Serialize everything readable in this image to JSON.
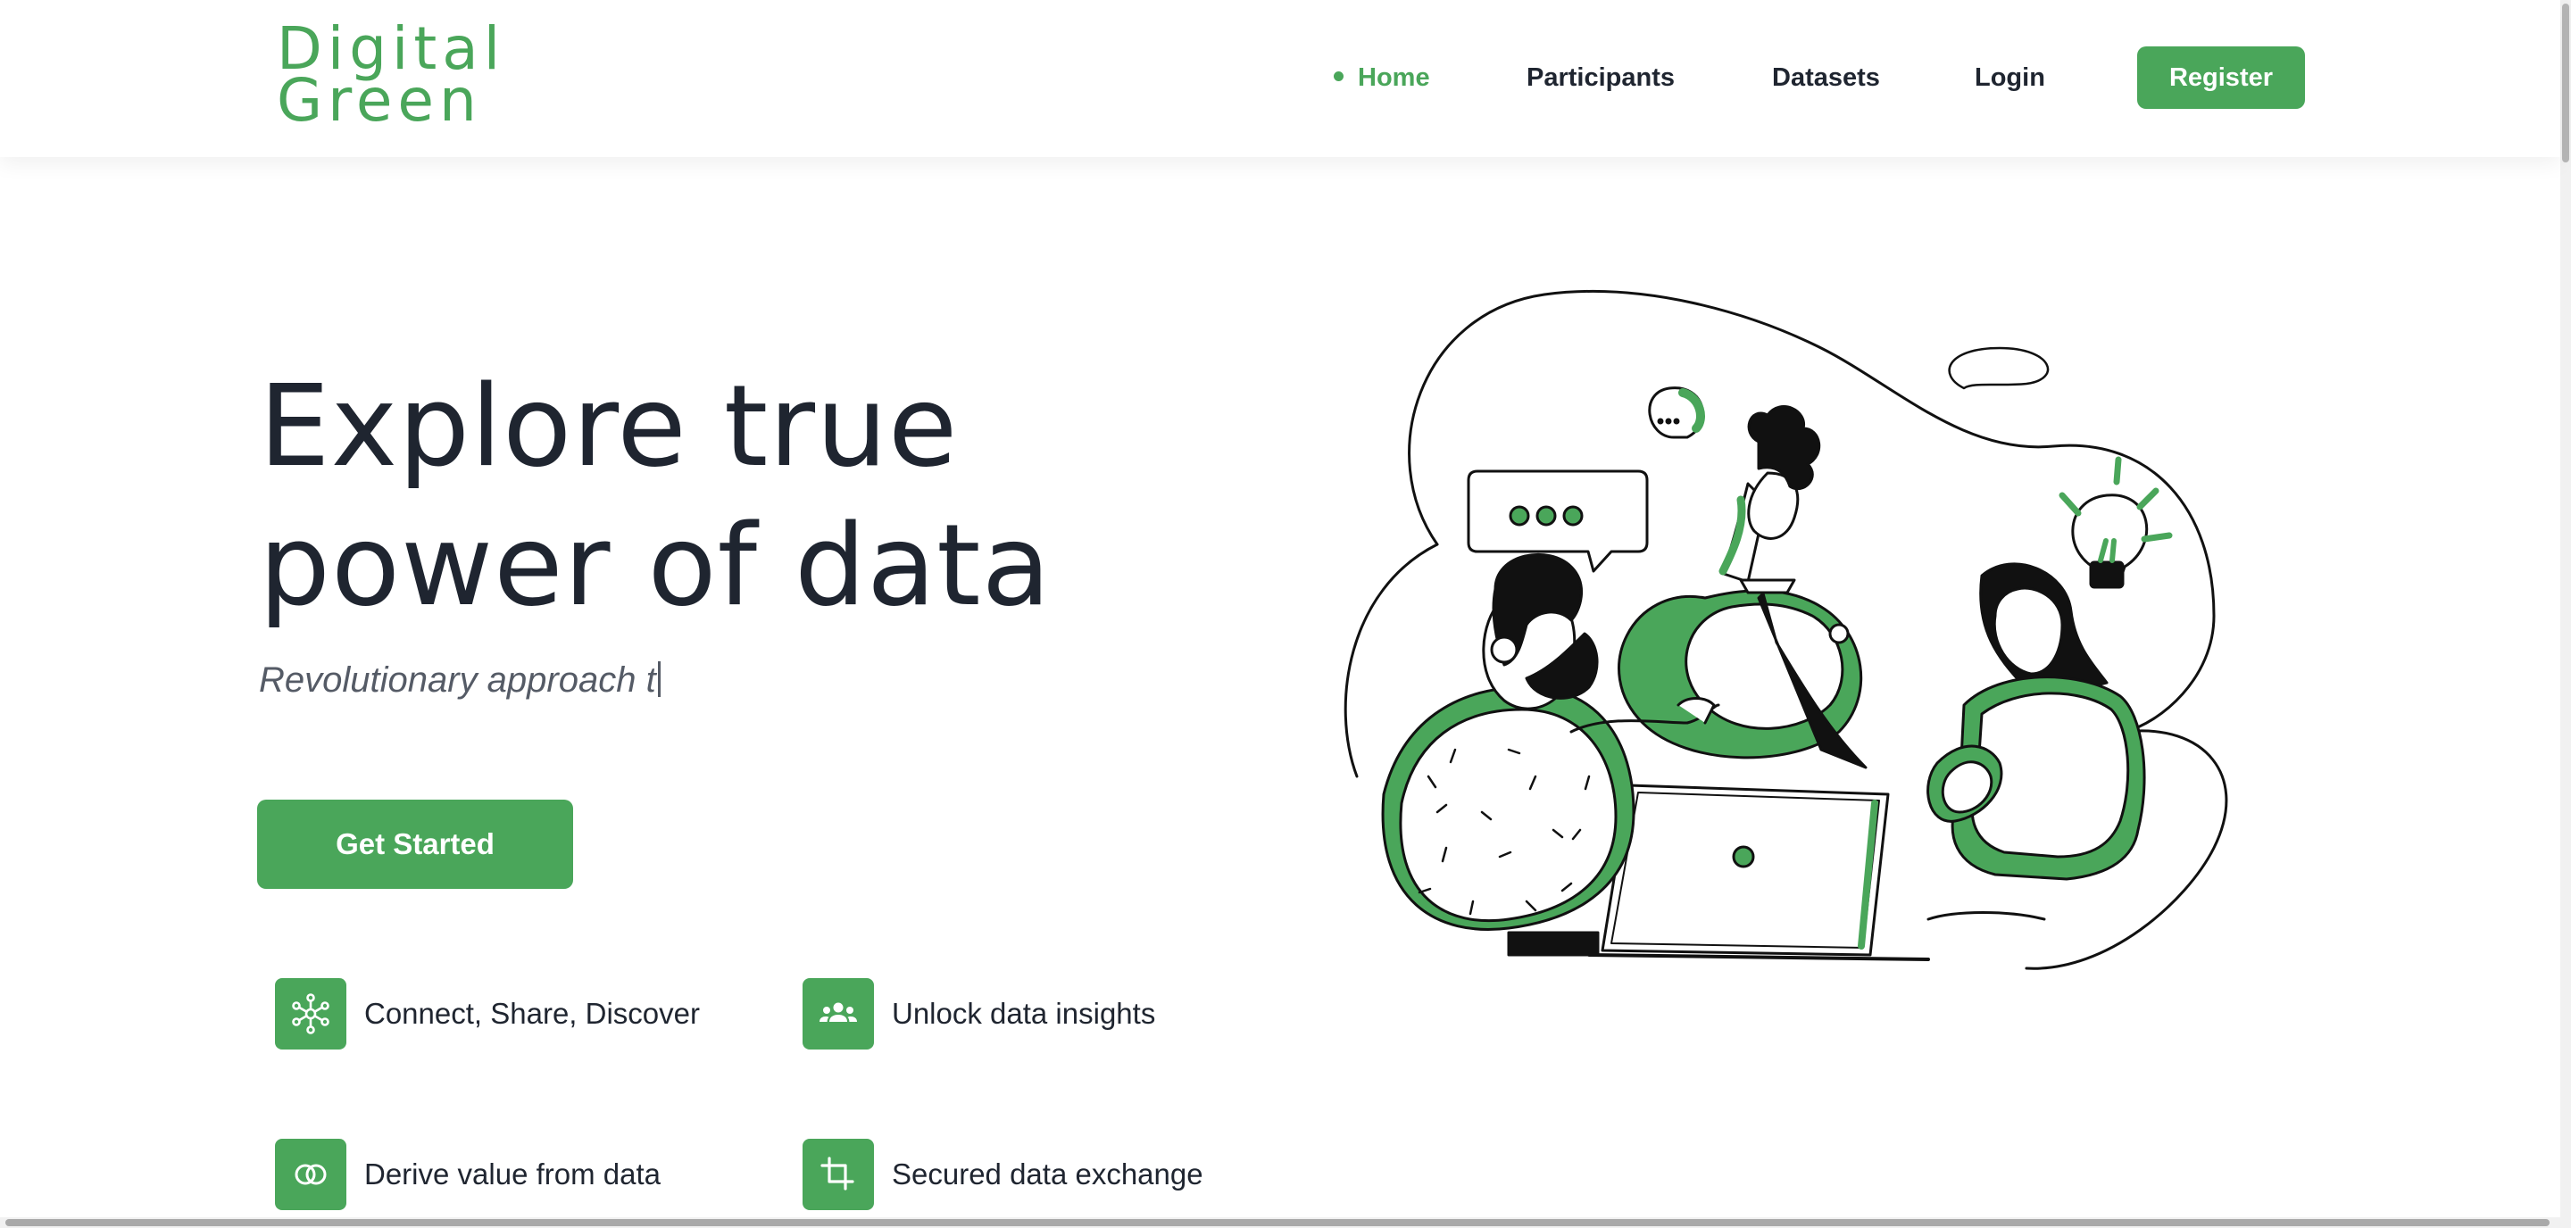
{
  "brand": {
    "line1": "Digital",
    "line2": "Green",
    "color": "#4aa65a"
  },
  "nav": {
    "home": "Home",
    "participants": "Participants",
    "datasets": "Datasets",
    "login": "Login",
    "register": "Register"
  },
  "hero": {
    "title_line1": "Explore true",
    "title_line2": "power of data",
    "subtitle": "Revolutionary approach t",
    "cta": "Get Started"
  },
  "features": [
    {
      "icon": "hub-network-icon",
      "label": "Connect, Share, Discover"
    },
    {
      "icon": "group-people-icon",
      "label": "Unlock data insights"
    },
    {
      "icon": "overlapping-circles-icon",
      "label": "Derive value from data"
    },
    {
      "icon": "crop-icon",
      "label": "Secured data exchange"
    }
  ],
  "illustration": {
    "name": "team-collaboration-illustration",
    "accent": "#4aa65a"
  }
}
